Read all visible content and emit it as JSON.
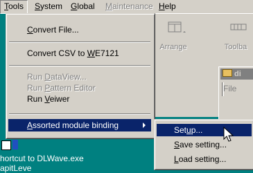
{
  "menubar": {
    "items": [
      {
        "key": "T",
        "rest": "ools"
      },
      {
        "key": "S",
        "rest": "ystem"
      },
      {
        "key": "G",
        "rest": "lobal"
      },
      {
        "key": "M",
        "rest": "aintenance"
      },
      {
        "key": "H",
        "rest": "elp"
      }
    ]
  },
  "tools_menu": {
    "convert_file": {
      "key": "C",
      "rest": "onvert File..."
    },
    "convert_csv": {
      "pre": "Convert CSV to ",
      "key": "W",
      "rest": "E7121"
    },
    "run_dataview": {
      "pre": "Run ",
      "key": "D",
      "rest": "ataView..."
    },
    "run_pattern_editor": {
      "pre": "Run ",
      "key": "P",
      "rest": "attern Editor"
    },
    "run_viewer": {
      "pre": "Run ",
      "key": "V",
      "rest": "eiwer"
    },
    "assorted": {
      "key": "A",
      "rest": "ssorted module binding"
    }
  },
  "submenu": {
    "setup": {
      "pre": "Set",
      "key": "u",
      "rest": "p..."
    },
    "save": {
      "key": "S",
      "rest": "ave setting..."
    },
    "load": {
      "key": "L",
      "rest": "oad setting..."
    }
  },
  "background_window": {
    "arrange_label": "Arrange",
    "toolbar_label": "Toolba",
    "child_title": "di",
    "child_menu": "File"
  },
  "desktop": {
    "shortcut_line1": "hortcut to DLWave.exe",
    "shortcut_line2": "apitLeve"
  },
  "colors": {
    "desktop": "#008080",
    "selection": "#0a246a",
    "face": "#d4d0c8"
  }
}
